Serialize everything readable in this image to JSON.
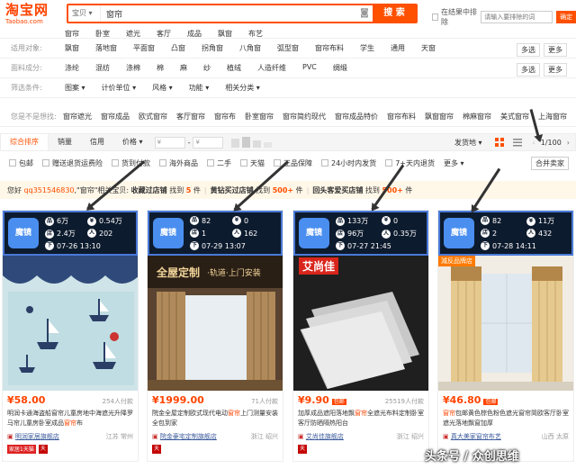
{
  "header": {
    "logo_cn": "淘宝网",
    "logo_en": "Taobao.com",
    "search_type": "宝贝",
    "search_value": "窗帘",
    "search_button": "搜 索",
    "within_label": "在结果中排除",
    "within_placeholder": "请输入要排除的词",
    "within_ok": "确定"
  },
  "filters": {
    "row0": [
      "窗帘",
      "卧室",
      "遮光",
      "客厅",
      "成品",
      "飘窗",
      "布艺"
    ],
    "row1_label": "适用对象:",
    "row1": [
      "飘窗",
      "落地窗",
      "平面窗",
      "凸窗",
      "拐角窗",
      "八角窗",
      "弧型窗",
      "窗帘布料",
      "学生",
      "通用",
      "天窗"
    ],
    "row2_label": "面料成分:",
    "row2": [
      "涤纶",
      "混纺",
      "涤棉",
      "棉",
      "麻",
      "纱",
      "植绒",
      "人造纤维",
      "PVC",
      "绸缎"
    ],
    "row3_label": "筛选条件:",
    "row3": [
      "图案",
      "计价单位",
      "风格",
      "功能",
      "相关分类"
    ],
    "multi": "多选",
    "more": "更多"
  },
  "suggest": {
    "label": "您是不是想找:",
    "items": [
      "窗帘遮光",
      "窗帘成品",
      "欧式窗帘",
      "客厅窗帘",
      "窗帘布",
      "卧室窗帘",
      "窗帘简约现代",
      "窗帘成品特价",
      "窗帘布料",
      "飘窗窗帘",
      "棉麻窗帘",
      "美式窗帘",
      "上海窗帘"
    ]
  },
  "sortbar": {
    "tabs": [
      "综合排序",
      "销量",
      "信用",
      "价格"
    ],
    "price_from": "¥",
    "price_to": "¥",
    "ship": "发货地",
    "page": "1/100"
  },
  "checks": [
    "包邮",
    "赠送退货运费险",
    "货到付款",
    "海外商品",
    "二手",
    "天猫",
    "正品保障",
    "24小时内发货",
    "7+天内退货",
    "更多"
  ],
  "merge": "合并卖家",
  "notice": {
    "a": "您好",
    "user": "qq351546830",
    "b": ",\"窗帘\"相关宝贝:",
    "c": "收藏过店铺",
    "c_n": "5",
    "d": "黄钻买过店铺",
    "d_n": "500+",
    "e": "回头客爱买店铺",
    "e_n": "500+",
    "unit": "件"
  },
  "products": [
    {
      "logo": "魔镜",
      "s1": "6万",
      "s2": "0.54万",
      "s3": "2.4万",
      "s4": "202",
      "date": "07-26 13:10",
      "price": "¥58.00",
      "pay": "254人付款",
      "free_ship": "",
      "title_a": "明润卡通海盗船窗帘儿童房地中海遮光升降罗马帘儿童房卧室成品",
      "title_hl": "窗帘",
      "title_b": "布",
      "shop": "明润家居旗舰店",
      "loc": "江苏 常州",
      "tag": "家居1天猫"
    },
    {
      "logo": "魔镜",
      "s1": "82",
      "s2": "0",
      "s3": "1",
      "s4": "162",
      "date": "07-29 13:07",
      "price": "¥1999.00",
      "pay": "71人付款",
      "free_ship": "",
      "title_a": "院金全屋定制欧式现代电动",
      "title_hl": "窗帘",
      "title_b": "上门测量安装全包到家",
      "shop": "院金豪宅定制旗舰店",
      "loc": "浙江 绍兴",
      "tag": ""
    },
    {
      "logo": "魔镜",
      "s1": "133万",
      "s2": "0",
      "s3": "96万",
      "s4": "0.35万",
      "date": "07-27 21:45",
      "price": "¥9.90",
      "pay": "25519人付款",
      "free_ship": "包邮",
      "title_a": "加厚成品遮阳落地飘",
      "title_hl": "窗帘",
      "title_b": "全遮光布料定制卧室客厅防晒隔热阳台",
      "shop": "艾尚佳旗舰店",
      "loc": "浙江 绍兴",
      "tag": ""
    },
    {
      "logo": "魔镜",
      "s1": "82",
      "s2": "11万",
      "s3": "2",
      "s4": "432",
      "date": "07-28 14:11",
      "price": "¥46.80",
      "pay": "",
      "free_ship": "包邮",
      "title_a": "",
      "title_hl": "窗帘",
      "title_b": "包邮黄色棕色粉色遮光窗帘简欧客厅卧室遮光落地飘窗加厚",
      "shop": "真大美家窗帘布艺",
      "loc": "山西 太原",
      "tag": ""
    }
  ],
  "image_texts": {
    "p1_stamp": "",
    "p2_title": "全屋定制",
    "p2_sub": "·轨道·上门安装",
    "p3_brand": "艾尚佳",
    "p4_badge": "減反品牌店"
  },
  "watermark": "头条号 / 众创思维",
  "colors": {
    "accent": "#ff5000",
    "price": "#ff4400",
    "stat_bg": "#0d1b2e",
    "stat_border": "#4a7ad8"
  }
}
